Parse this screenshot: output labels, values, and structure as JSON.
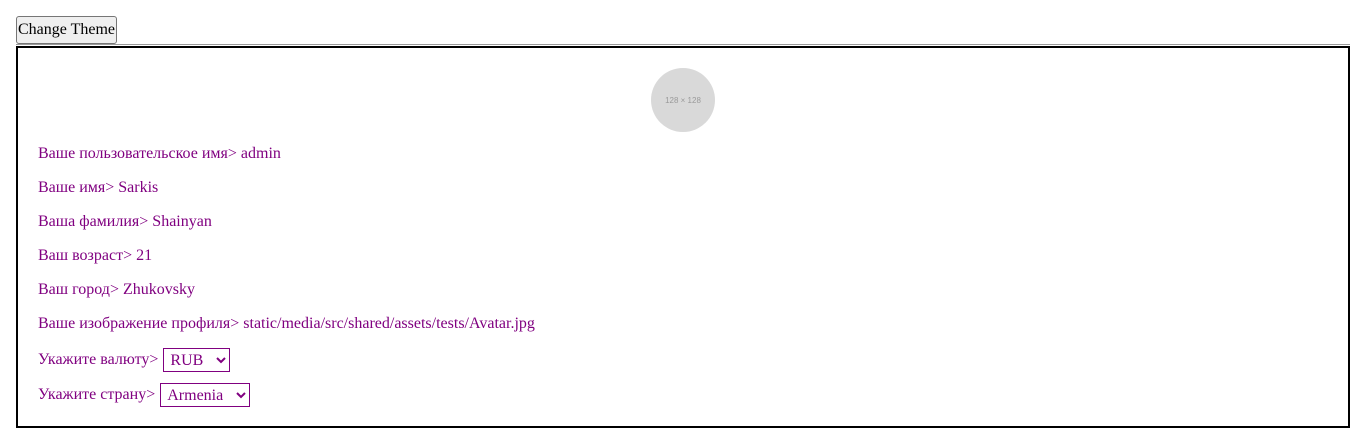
{
  "header": {
    "theme_button_label": "Change Theme"
  },
  "profile": {
    "avatar_placeholder": "128 × 128",
    "fields": [
      {
        "label": "Ваше пользовательское имя",
        "value": "admin"
      },
      {
        "label": "Ваше имя",
        "value": "Sarkis"
      },
      {
        "label": "Ваша фамилия",
        "value": "Shainyan"
      },
      {
        "label": "Ваш возраст",
        "value": "21"
      },
      {
        "label": "Ваш город",
        "value": "Zhukovsky"
      },
      {
        "label": "Ваше изображение профиля",
        "value": "static/media/src/shared/assets/tests/Avatar.jpg"
      }
    ],
    "currency": {
      "label": "Укажите валюту",
      "selected": "RUB"
    },
    "country": {
      "label": "Укажите страну",
      "selected": "Armenia"
    },
    "separator": ">"
  },
  "colors": {
    "text": "#800080",
    "border": "#000000",
    "avatar_bg": "#d9d9d9"
  }
}
